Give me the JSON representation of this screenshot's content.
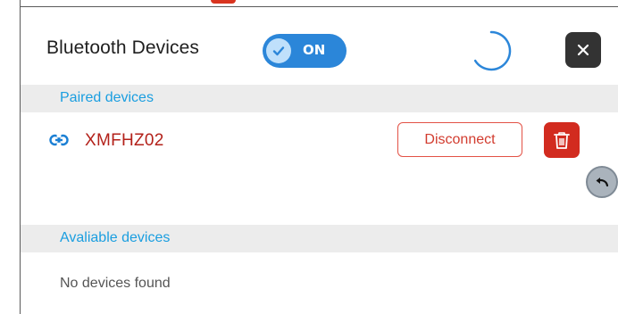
{
  "header": {
    "title": "Bluetooth Devices",
    "toggle_label": "ON",
    "toggle_state": "on"
  },
  "paired": {
    "section_label": "Paired devices",
    "devices": [
      {
        "name": "XMFHZ02",
        "action_label": "Disconnect"
      }
    ]
  },
  "available": {
    "section_label": "Avaliable devices",
    "empty_text": "No devices found"
  },
  "icons": {
    "close": "close-icon",
    "spinner": "loading-spinner-icon",
    "link": "link-icon",
    "trash": "trash-icon",
    "back": "undo-arrow-icon",
    "toggle_check": "check-icon"
  },
  "colors": {
    "accent_blue": "#2b86d9",
    "section_text": "#1a9ee0",
    "device_name": "#b3211a",
    "danger": "#d22b1f",
    "close_bg": "#333333"
  }
}
